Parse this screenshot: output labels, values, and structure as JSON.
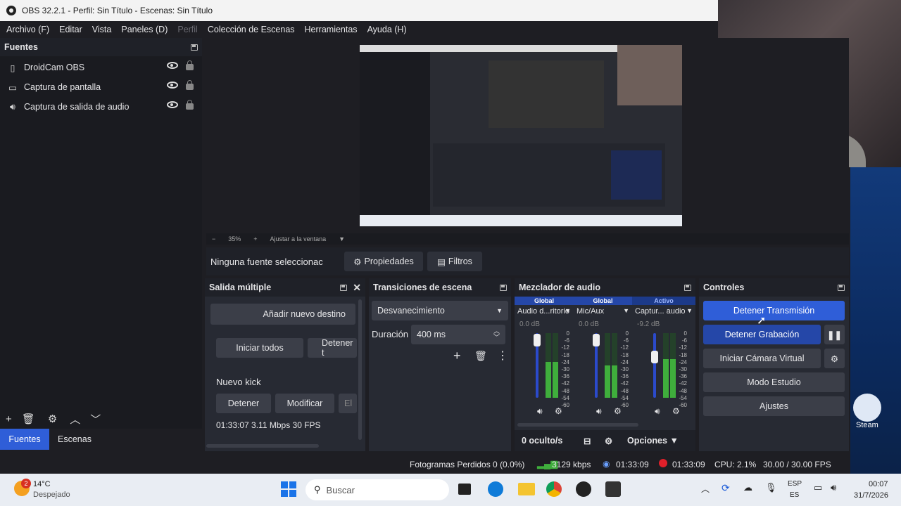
{
  "window": {
    "title": "OBS 32.2.1 - Perfil: Sin Título - Escenas: Sin Título"
  },
  "menu": [
    "Archivo (F)",
    "Editar",
    "Vista",
    "Paneles (D)",
    "Perfil",
    "Colección de Escenas",
    "Herramientas",
    "Ayuda (H)"
  ],
  "sources": {
    "title": "Fuentes",
    "items": [
      {
        "label": "DroidCam OBS",
        "icon": "camera-icon"
      },
      {
        "label": "Captura de pantalla",
        "icon": "monitor-icon"
      },
      {
        "label": "Captura de salida de audio",
        "icon": "speaker-icon"
      }
    ]
  },
  "bottom_tabs": {
    "sources": "Fuentes",
    "scenes": "Escenas"
  },
  "preview": {
    "zoom": "35%",
    "fit": "Ajustar a la ventana"
  },
  "context": {
    "no_source": "Ninguna fuente seleccionac",
    "properties": "Propiedades",
    "filters": "Filtros"
  },
  "multi": {
    "title": "Salida múltiple",
    "add": "Añadir nuevo destino",
    "start_all": "Iniciar todos",
    "stop_all": "Detener t",
    "target_name": "Nuevo kick",
    "stop": "Detener",
    "modify": "Modificar",
    "delete": "El",
    "stats": "01:33:07  3.11 Mbps  30 FPS"
  },
  "transitions": {
    "title": "Transiciones de escena",
    "selected": "Desvanecimiento",
    "duration_label": "Duración",
    "duration_value": "400 ms"
  },
  "mixer": {
    "title": "Mezclador de audio",
    "channels": [
      {
        "badge": "Global",
        "name": "Audio d...ritorio",
        "db": "0.0 dB",
        "level": 0.55,
        "fader": 0.95
      },
      {
        "badge": "Global",
        "name": "Mic/Aux",
        "db": "0.0 dB",
        "level": 0.5,
        "fader": 0.95
      },
      {
        "badge": "Activo",
        "name": "Captur... audio",
        "db": "-9.2 dB",
        "level": 0.6,
        "fader": 0.68
      }
    ],
    "scale": [
      "0",
      "-6",
      "-12",
      "-18",
      "-24",
      "-30",
      "-36",
      "-42",
      "-48",
      "-54",
      "-60"
    ],
    "hidden": "0 oculto/s",
    "options": "Opciones"
  },
  "controls": {
    "title": "Controles",
    "stop_stream": "Detener Transmisión",
    "stop_record": "Detener Grabación",
    "virtual_cam": "Iniciar Cámara Virtual",
    "studio": "Modo Estudio",
    "settings": "Ajustes"
  },
  "status": {
    "dropped": "Fotogramas Perdidos 0 (0.0%)",
    "bitrate": "3129 kbps",
    "stream_time": "01:33:09",
    "record_time": "01:33:09",
    "cpu": "CPU: 2.1%",
    "fps": "30.00 / 30.00 FPS"
  },
  "desktop": {
    "steam": "Steam"
  },
  "taskbar": {
    "temp": "14°C",
    "weather": "Despejado",
    "badge": "2",
    "search": "Buscar",
    "lang1": "ESP",
    "lang2": "ES",
    "time": "00:07",
    "date": "31/7/2026"
  },
  "colors": {
    "accent": "#2f5ed8",
    "record": "#e0202a",
    "meter": "#3fae3c"
  }
}
